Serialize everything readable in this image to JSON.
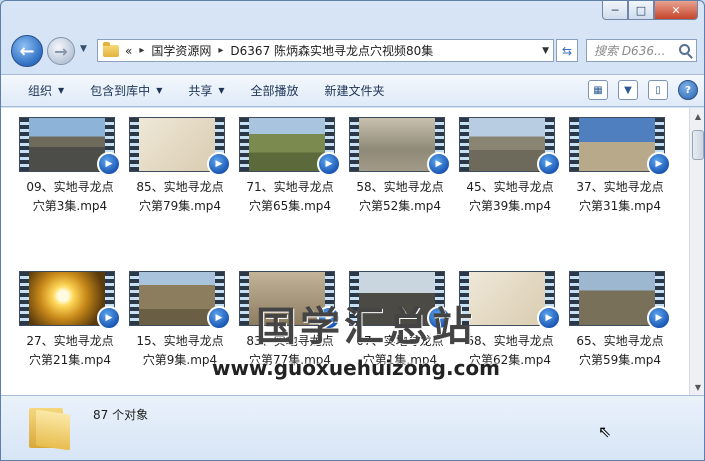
{
  "window": {
    "caption": {
      "minimize": "─",
      "maximize": "□",
      "close": "✕"
    }
  },
  "address": {
    "overflow": "«",
    "crumbs": [
      "国学资源网",
      "D6367 陈炳森实地寻龙点穴视频80集"
    ],
    "separator": "▸"
  },
  "search": {
    "placeholder": "搜索 D636..."
  },
  "toolbar": {
    "organize": "组织",
    "include_in_library": "包含到库中",
    "share": "共享",
    "play_all": "全部播放",
    "new_folder": "新建文件夹"
  },
  "files": [
    {
      "line1": "09、实地寻龙点",
      "line2": "穴第3集.mp4",
      "scene": "solar"
    },
    {
      "line1": "85、实地寻龙点",
      "line2": "穴第79集.mp4",
      "scene": "bamboo"
    },
    {
      "line1": "71、实地寻龙点",
      "line2": "穴第65集.mp4",
      "scene": "hill-man"
    },
    {
      "line1": "58、实地寻龙点",
      "line2": "穴第52集.mp4",
      "scene": "terrain"
    },
    {
      "line1": "45、实地寻龙点",
      "line2": "穴第39集.mp4",
      "scene": "valley"
    },
    {
      "line1": "37、实地寻龙点",
      "line2": "穴第31集.mp4",
      "scene": "man-field"
    },
    {
      "line1": "27、实地寻龙点",
      "line2": "穴第21集.mp4",
      "scene": "sun"
    },
    {
      "line1": "15、实地寻龙点",
      "line2": "穴第9集.mp4",
      "scene": "slope"
    },
    {
      "line1": "83、实地寻龙点",
      "line2": "穴第77集.mp4",
      "scene": "hand-compass"
    },
    {
      "line1": "07、实地寻龙点",
      "line2": "穴第1集.mp4",
      "scene": "man-dark"
    },
    {
      "line1": "68、实地寻龙点",
      "line2": "穴第62集.mp4",
      "scene": "bamboo"
    },
    {
      "line1": "65、实地寻龙点",
      "line2": "穴第59集.mp4",
      "scene": "man-hill"
    }
  ],
  "watermark": {
    "title": "国学汇总站",
    "url": "www.guoxuehuizong.com"
  },
  "status": {
    "count": "87 个对象"
  }
}
